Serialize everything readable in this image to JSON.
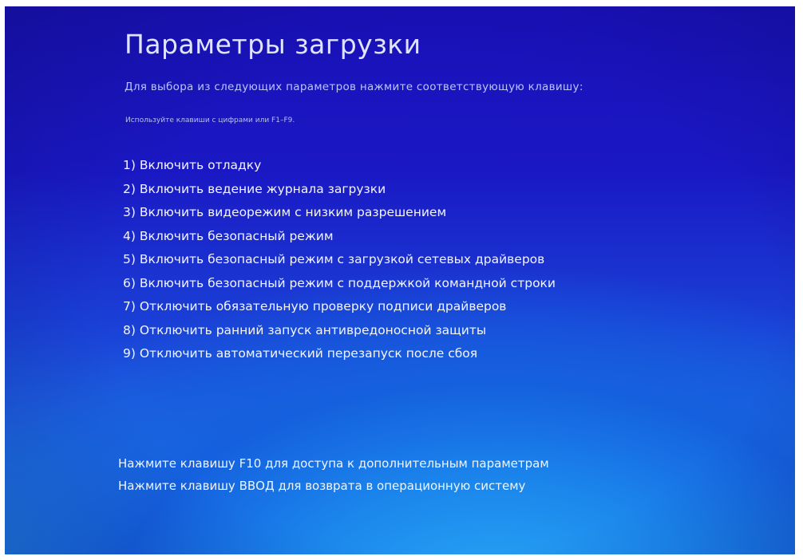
{
  "screen": {
    "title": "Параметры загрузки",
    "subtitle": "Для выбора из следующих параметров нажмите соответствующую клавишу:",
    "hint": "Используйте клавиши с цифрами или F1–F9.",
    "options": [
      "1) Включить отладку",
      "2) Включить ведение журнала загрузки",
      "3) Включить видеорежим с низким разрешением",
      "4) Включить безопасный режим",
      "5) Включить безопасный режим с загрузкой сетевых драйверов",
      "6) Включить безопасный режим с поддержкой командной строки",
      "7) Отключить обязательную проверку подписи драйверов",
      "8) Отключить ранний запуск антивредоносной защиты",
      "9) Отключить автоматический перезапуск после сбоя"
    ],
    "footer": {
      "f10": "Нажмите клавишу F10 для доступа к дополнительным параметрам",
      "enter": "Нажмите клавишу ВВОД для возврата в операционную систему"
    }
  },
  "colors": {
    "background_top": "#1a10b8",
    "background_bottom": "#258ee8",
    "text": "#f3f5ff"
  }
}
